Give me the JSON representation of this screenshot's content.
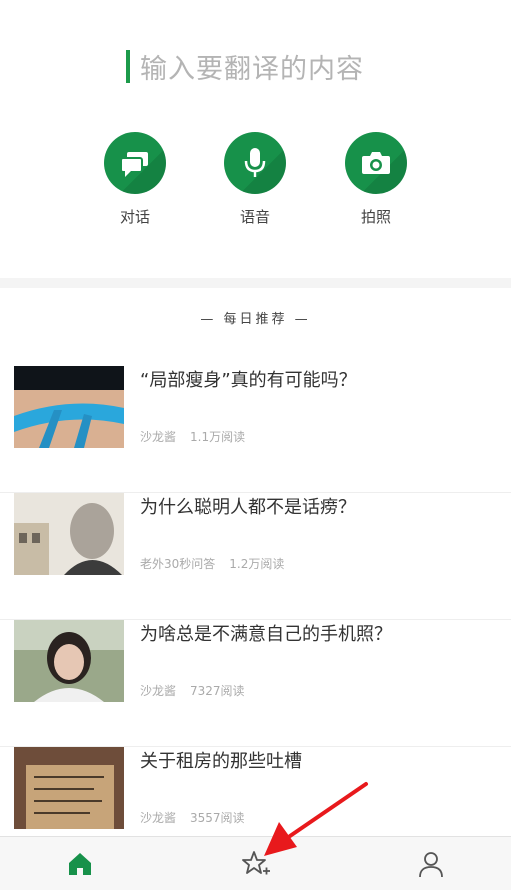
{
  "translate": {
    "placeholder": "输入要翻译的内容"
  },
  "modes": [
    {
      "label": "对话",
      "icon": "chat-bubbles-icon"
    },
    {
      "label": "语音",
      "icon": "microphone-icon"
    },
    {
      "label": "拍照",
      "icon": "camera-icon"
    }
  ],
  "recommend": {
    "title": "— 每日推荐 —",
    "articles": [
      {
        "title": "“局部瘦身”真的有可能吗？",
        "author": "沙龙酱",
        "reads": "1.1万阅读"
      },
      {
        "title": "为什么聪明人都不是话痨？",
        "author": "老外30秒问答",
        "reads": "1.2万阅读"
      },
      {
        "title": "为啥总是不满意自己的手机照？",
        "author": "沙龙酱",
        "reads": "7327阅读"
      },
      {
        "title": "关于租房的那些吐槽",
        "author": "沙龙酱",
        "reads": "3557阅读"
      }
    ]
  },
  "tabbar": {
    "items": [
      "home-icon",
      "star-plus-icon",
      "user-icon"
    ]
  },
  "colors": {
    "accent": "#17914a",
    "arrow": "#e8191c"
  }
}
